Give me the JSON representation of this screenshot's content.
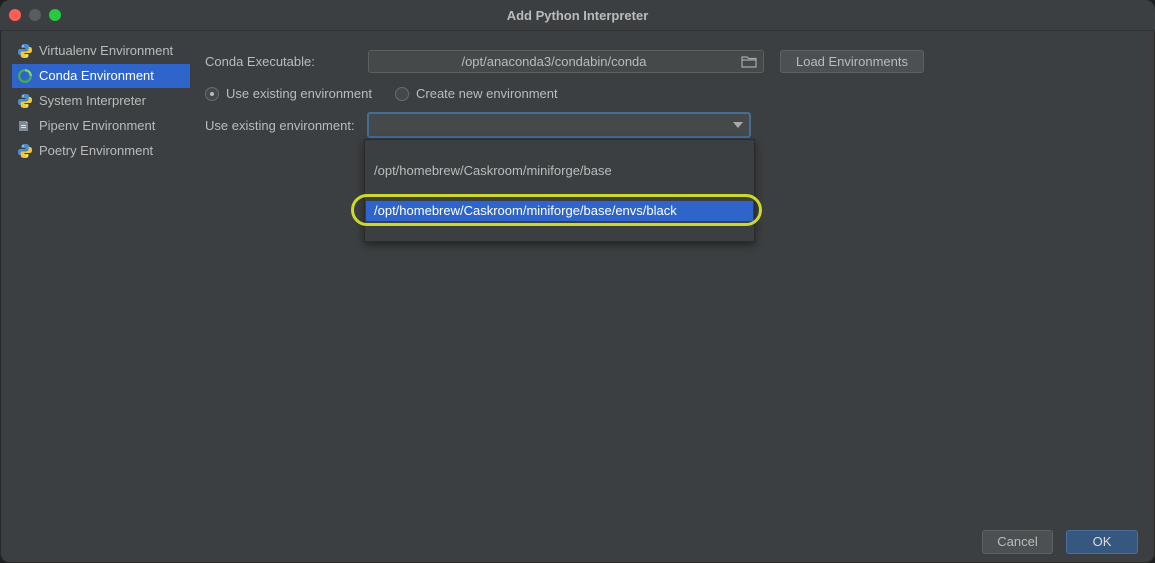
{
  "window": {
    "title": "Add Python Interpreter"
  },
  "sidebar": {
    "items": [
      {
        "label": "Virtualenv Environment",
        "icon": "python-icon",
        "selected": false
      },
      {
        "label": "Conda Environment",
        "icon": "conda-icon",
        "selected": true
      },
      {
        "label": "System Interpreter",
        "icon": "python-icon",
        "selected": false
      },
      {
        "label": "Pipenv Environment",
        "icon": "pipenv-icon",
        "selected": false
      },
      {
        "label": "Poetry Environment",
        "icon": "python-icon",
        "selected": false
      }
    ]
  },
  "form": {
    "conda_executable_label": "Conda Executable:",
    "conda_executable_value": "/opt/anaconda3/condabin/conda",
    "load_environments_label": "Load Environments",
    "radio_existing_label": "Use existing environment",
    "radio_new_label": "Create new environment",
    "existing_env_label": "Use existing environment:",
    "existing_env_value": ""
  },
  "dropdown": {
    "options": [
      "/opt/homebrew/Caskroom/miniforge/base",
      "/opt/homebrew/Caskroom/miniforge/base/envs/black"
    ],
    "selected_index": 1
  },
  "footer": {
    "cancel_label": "Cancel",
    "ok_label": "OK"
  },
  "colors": {
    "selection": "#2f65ca",
    "highlight_ring": "#cbd92c",
    "background": "#3c3f41"
  }
}
